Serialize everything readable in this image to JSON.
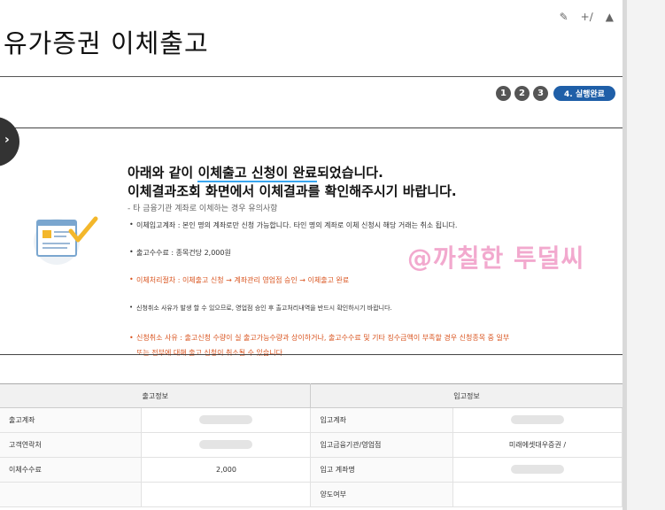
{
  "header": {
    "title": "유가증권 이체출고",
    "icons": [
      "memo-icon",
      "calculator-icon",
      "font-size-icon"
    ]
  },
  "steps": {
    "items": [
      "1",
      "2",
      "3"
    ],
    "active_label": "4. 실행완료"
  },
  "notice": {
    "headline_pre": "아래와 같이 ",
    "headline_highlight": "이체출고 신청이 완료",
    "headline_post": "되었습니다.",
    "headline_line2": "이체결과조회 화면에서 이체결과를 확인해주시기 바랍니다.",
    "caption": "- 타 금융기관 계좌로 이체하는 경우 유의사항",
    "bullets": {
      "b1": "이체입고계좌 : 본인 명의 계좌로만 신청 가능합니다. 타인 명의 계좌로 이체 신청시 해당 거래는 취소 됩니다.",
      "b2": "출고수수료 : 종목건당 2,000원",
      "b3": "이체처리절차 : 이체출고 신청 → 계좌관리 영업점 승인 → 이체출고 완료",
      "b4": "신청취소 사유가 발생 할 수 있으므로, 영업점 승인 후 출고처리내역을 반드시 확인하시기 바랍니다.",
      "b5_line1": "신청취소 사유 : 출고신청 수량이 실 출고가능수량과 상이하거나, 출고수수료 및 기타 징수금액이 부족할 경우 신청종목 중 일부",
      "b5_line2": "또는 전부에 대해 출고 신청이 취소될 수 있습니다."
    }
  },
  "watermark": "@까칠한 투덜씨",
  "table": {
    "out_header": "출고정보",
    "in_header": "입고정보",
    "rows": [
      {
        "out_label": "출고계좌",
        "out_value": "",
        "in_label": "입고계좌",
        "in_value": ""
      },
      {
        "out_label": "고객연락처",
        "out_value": "",
        "in_label": "입고금융기관/영업점",
        "in_value": "미래에셋대우증권 /"
      },
      {
        "out_label": "이체수수료",
        "out_value": "2,000",
        "in_label": "입고 계좌명",
        "in_value": ""
      },
      {
        "out_label": "",
        "out_value": "",
        "in_label": "양도여부",
        "in_value": ""
      }
    ]
  },
  "colors": {
    "accent": "#1f5fa8",
    "warning_text": "#d9531e",
    "highlight_underline": "#3aa7f0",
    "watermark": "#ee8cbe"
  }
}
